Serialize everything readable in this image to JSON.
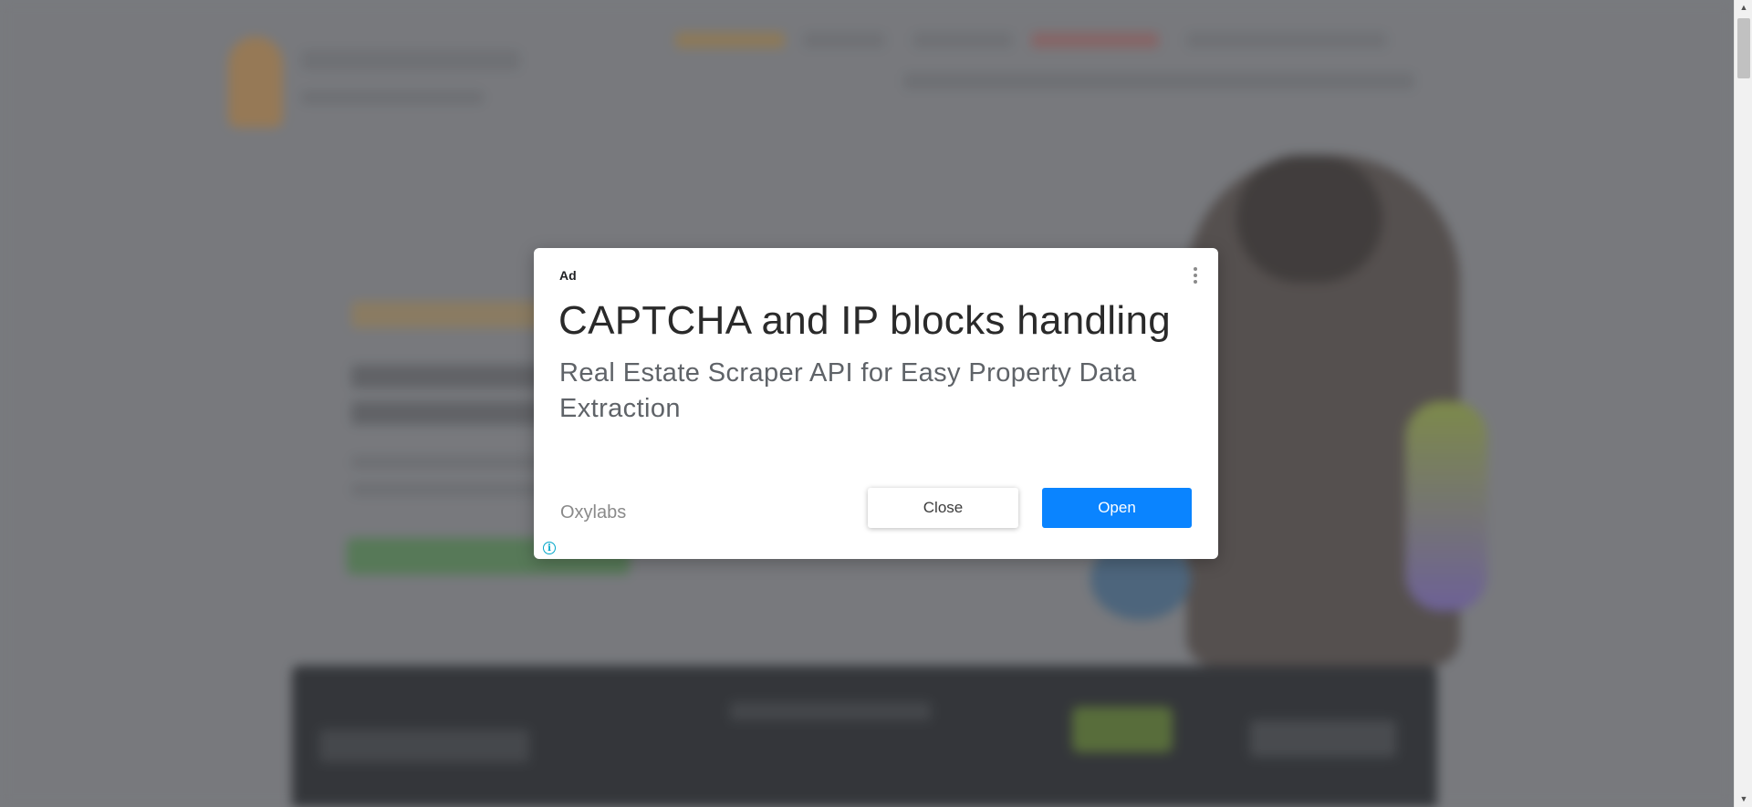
{
  "ad": {
    "label": "Ad",
    "headline": "CAPTCHA and IP blocks handling",
    "subline": "Real Estate Scraper API for Easy Property Data Extraction",
    "advertiser": "Oxylabs",
    "close_label": "Close",
    "open_label": "Open",
    "info_glyph": "i",
    "menu_icon": "more-vertical-icon",
    "accent_color": "#0a84ff"
  },
  "scrollbar": {
    "up_glyph": "▲",
    "down_glyph": "▼"
  }
}
